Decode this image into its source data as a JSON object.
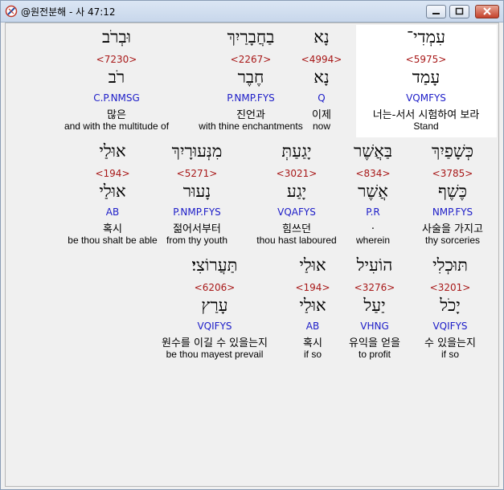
{
  "window": {
    "title": "@원전분해 - 사 47:12"
  },
  "rows": [
    [
      {
        "heb": "עִמְדִי־",
        "strong": "<5975>",
        "lemma": "עָמַד",
        "morph": "VQMFYS",
        "kor": "너는-서서 시험하여 보라",
        "eng": "Stand",
        "highlight": true
      },
      {
        "heb": "נָא",
        "strong": "<4994>",
        "lemma": "נָא",
        "morph": "Q",
        "kor": "이제",
        "eng": "now",
        "highlight": false
      },
      {
        "heb": "בַחֲבָרַיִךְ",
        "strong": "<2267>",
        "lemma": "חֶבֶר",
        "morph": "P.NMP.FYS",
        "kor": "진언과",
        "eng": "with thine enchantments",
        "highlight": false
      },
      {
        "heb": "וּבְרֹב",
        "strong": "<7230>",
        "lemma": "רֹב",
        "morph": "C.P.NMSG",
        "kor": "많은",
        "eng": "and with the multitude of",
        "highlight": false
      }
    ],
    [
      {
        "heb": "כְּשָׁפַיִךְ",
        "strong": "<3785>",
        "lemma": "כֶּשֶׁף",
        "morph": "NMP.FYS",
        "kor": "사술을 가지고",
        "eng": "thy sorceries",
        "highlight": false
      },
      {
        "heb": "בַּאֲשֶׁר",
        "strong": "<834>",
        "lemma": "אֲשֶׁר",
        "morph": "P.R",
        "kor": ".",
        "eng": "wherein",
        "highlight": false
      },
      {
        "heb": "יָגַעַתְּ",
        "strong": "<3021>",
        "lemma": "יָגַע",
        "morph": "VQAFYS",
        "kor": "힘쓰던",
        "eng": "thou hast laboured",
        "highlight": false
      },
      {
        "heb": "מִנְּעוּרָיִךְ",
        "strong": "<5271>",
        "lemma": "נָעוּר",
        "morph": "P.NMP.FYS",
        "kor": "젊어서부터",
        "eng": "from thy youth",
        "highlight": false
      },
      {
        "heb": "אוּלַי",
        "strong": "<194>",
        "lemma": "אוּלַי",
        "morph": "AB",
        "kor": "혹시",
        "eng": "be thou shalt be able",
        "highlight": false
      }
    ],
    [
      {
        "heb": "תּוּכְלִי",
        "strong": "<3201>",
        "lemma": "יָכֹל",
        "morph": "VQIFYS",
        "kor": "수 있을는지",
        "eng": "if so",
        "highlight": false
      },
      {
        "heb": "הוֹעִיל",
        "strong": "<3276>",
        "lemma": "יַעַל",
        "morph": "VHNG",
        "kor": "유익을 얻을",
        "eng": "to profit",
        "highlight": false
      },
      {
        "heb": "אוּלַי",
        "strong": "<194>",
        "lemma": "אוּלַי",
        "morph": "AB",
        "kor": "혹시",
        "eng": "if so",
        "highlight": false
      },
      {
        "heb": "תַּעֲרוֹצִי׃",
        "strong": "<6206>",
        "lemma": "עָרַץ",
        "morph": "VQIFYS",
        "kor": "원수를 이길 수 있을는지",
        "eng": "be thou mayest prevail",
        "highlight": false
      }
    ]
  ],
  "colors": {
    "strong": "#a81818",
    "morph": "#1c1cc8",
    "highlight": "#ffffff",
    "background": "#f0f0f0"
  },
  "icons": {
    "app": "app-icon",
    "minimize": "minimize-icon",
    "maximize": "maximize-icon",
    "close": "close-icon"
  }
}
